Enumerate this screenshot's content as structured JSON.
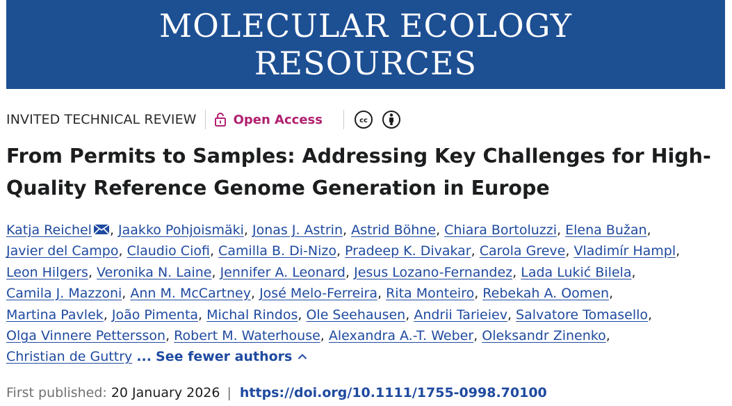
{
  "journal": {
    "line1": "MOLECULAR ECOLOGY",
    "line2": "RESOURCES",
    "brand_color": "#1d4f93"
  },
  "meta": {
    "article_type": "INVITED TECHNICAL REVIEW",
    "open_access_label": "Open Access",
    "icons": [
      "lock-icon",
      "creative-commons-icon",
      "attribution-icon"
    ]
  },
  "title": {
    "line1": "From Permits to Samples: Addressing Key Challenges for High-",
    "line2": "Quality Reference Genome Generation in Europe"
  },
  "authors": [
    "Katja Reichel",
    "Jaakko Pohjoismäki",
    "Jonas J. Astrin",
    "Astrid Böhne",
    "Chiara Bortoluzzi",
    "Elena Bužan",
    "Javier del Campo",
    "Claudio Ciofi",
    "Camilla B. Di-Nizo",
    "Pradeep K. Divakar",
    "Carola Greve",
    "Vladimír Hampl",
    "Leon Hilgers",
    "Veronika N. Laine",
    "Jennifer A. Leonard",
    "Jesus Lozano-Fernandez",
    "Lada Lukić Bilela",
    "Camila J. Mazzoni",
    "Ann M. McCartney",
    "José Melo-Ferreira",
    "Rita Monteiro",
    "Rebekah A. Oomen",
    "Martina Pavlek",
    "João Pimenta",
    "Michal Rindos",
    "Ole Seehausen",
    "Andrii Tarieiev",
    "Salvatore Tomasello",
    "Olga Vinnere Pettersson",
    "Robert M. Waterhouse",
    "Alexandra A.-T. Weber",
    "Oleksandr Zinenko",
    "Christian de Guttry"
  ],
  "authors_toggle": {
    "ellipsis": "...",
    "label": "See fewer authors"
  },
  "publication": {
    "first_published_label": "First published:",
    "date": "20 January 2026",
    "separator": "|",
    "doi": "https://doi.org/10.1111/1755-0998.70100"
  }
}
